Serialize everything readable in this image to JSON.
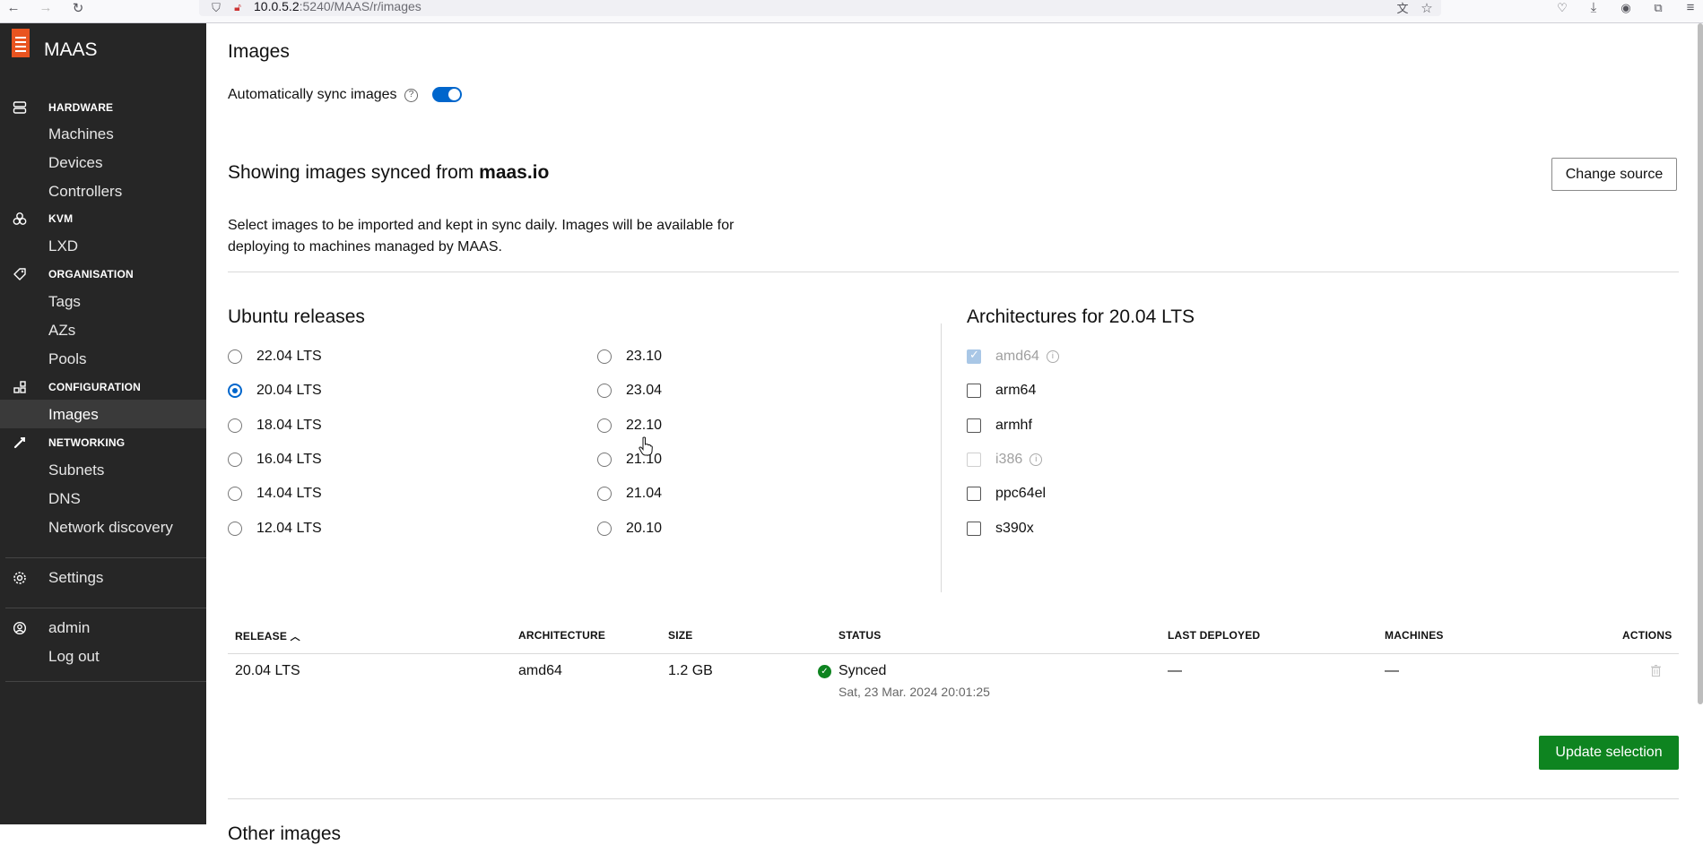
{
  "browser": {
    "url_host": "10.0.5.2",
    "url_rest": ":5240/MAAS/r/images"
  },
  "sidebar": {
    "brand": "MAAS",
    "sections": [
      {
        "heading": "HARDWARE",
        "icon": "server-icon",
        "items": [
          "Machines",
          "Devices",
          "Controllers"
        ]
      },
      {
        "heading": "KVM",
        "icon": "cluster-icon",
        "items": [
          "LXD"
        ]
      },
      {
        "heading": "ORGANISATION",
        "icon": "tag-icon",
        "items": [
          "Tags",
          "AZs",
          "Pools"
        ]
      },
      {
        "heading": "CONFIGURATION",
        "icon": "grid-icon",
        "items": [
          "Images"
        ]
      },
      {
        "heading": "NETWORKING",
        "icon": "connection-icon",
        "items": [
          "Subnets",
          "DNS",
          "Network discovery"
        ]
      }
    ],
    "settings": "Settings",
    "user": "admin",
    "logout": "Log out",
    "active_item": "Images"
  },
  "main": {
    "title": "Images",
    "auto_sync_label": "Automatically sync images",
    "auto_sync_enabled": true,
    "showing_prefix": "Showing images synced from ",
    "showing_source": "maas.io",
    "change_source": "Change source",
    "description": "Select images to be imported and kept in sync daily. Images will be available for deploying to machines managed by MAAS.",
    "ubuntu_heading": "Ubuntu releases",
    "releases_left": [
      "22.04 LTS",
      "20.04 LTS",
      "18.04 LTS",
      "16.04 LTS",
      "14.04 LTS",
      "12.04 LTS"
    ],
    "releases_right": [
      "23.10",
      "23.04",
      "22.10",
      "21.10",
      "21.04",
      "20.10"
    ],
    "selected_release": "20.04 LTS",
    "arch_heading": "Architectures for 20.04 LTS",
    "architectures": [
      {
        "name": "amd64",
        "state": "checked-disabled",
        "info": true
      },
      {
        "name": "arm64",
        "state": "unchecked",
        "info": false
      },
      {
        "name": "armhf",
        "state": "unchecked",
        "info": false
      },
      {
        "name": "i386",
        "state": "disabled",
        "info": true
      },
      {
        "name": "ppc64el",
        "state": "unchecked",
        "info": false
      },
      {
        "name": "s390x",
        "state": "unchecked",
        "info": false
      }
    ],
    "table": {
      "headers": {
        "release": "RELEASE",
        "architecture": "ARCHITECTURE",
        "size": "SIZE",
        "status": "STATUS",
        "last_deployed": "LAST DEPLOYED",
        "machines": "MACHINES",
        "actions": "ACTIONS"
      },
      "rows": [
        {
          "release": "20.04 LTS",
          "architecture": "amd64",
          "size": "1.2 GB",
          "status": "Synced",
          "status_time": "Sat, 23 Mar. 2024 20:01:25",
          "last_deployed": "—",
          "machines": "—"
        }
      ]
    },
    "update_selection": "Update selection",
    "other_images": "Other images"
  }
}
